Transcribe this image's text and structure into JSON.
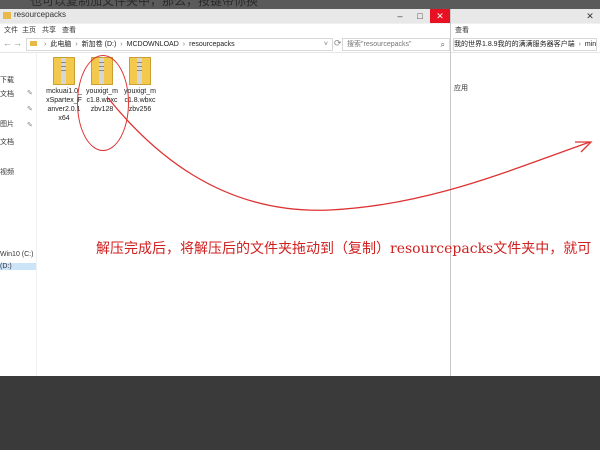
{
  "background_top_text": "也可以复制加文件夹中，那么，按键带你换",
  "left_window": {
    "title": "resourcepacks",
    "ribbon": [
      "文件",
      "主页",
      "共享",
      "查看"
    ],
    "breadcrumbs": [
      "此电脑",
      "新加卷 (D:)",
      "MCDOWNLOAD",
      "resourcepacks"
    ],
    "search_placeholder": "搜索\"resourcepacks\"",
    "sidebar_items": [
      "",
      "",
      "下载",
      "文档",
      "图片",
      "文档",
      "",
      "",
      "视频",
      "",
      "",
      "",
      "Win10 (C:)",
      "(D:)",
      "",
      "",
      "",
      "",
      ""
    ],
    "files": [
      {
        "name": "mckuai1.0_xSpartex_Fanver2.0.1 x64",
        "lines": [
          "mckuai1.0_",
          "xSpartex_F",
          "anver2.0.1",
          "x64"
        ]
      },
      {
        "name": "youxigt_mc1.8.wbxczbv128",
        "lines": [
          "youxigt_m",
          "c1.8.wbxc",
          "zbv128"
        ]
      },
      {
        "name": "youxigt_mc1.8.wbxczbv256",
        "lines": [
          "youxigt_m",
          "c1.8.wbxc",
          "zbv256"
        ]
      }
    ]
  },
  "right_window": {
    "ribbon": [
      "查看"
    ],
    "breadcrumbs": [
      "我的世界1.8.9我的的满满服务器客户端",
      "mine"
    ],
    "sidebar_text": "应用"
  },
  "annotation": "解压完成后，将解压后的文件夹拖动到（复制）resourcepacks文件夹中，就可",
  "colors": {
    "accent": "#d02020",
    "folder": "#f2c94c",
    "close": "#e81123"
  }
}
